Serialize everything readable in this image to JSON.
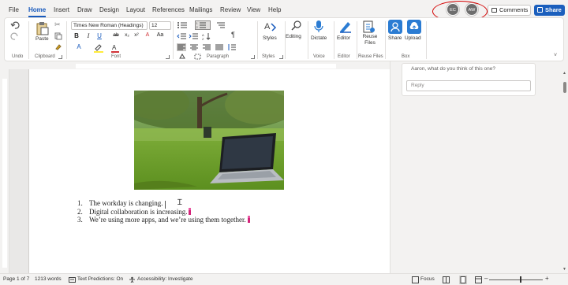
{
  "menu": {
    "tabs": [
      "File",
      "Home",
      "Insert",
      "Draw",
      "Design",
      "Layout",
      "References",
      "Mailings",
      "Review",
      "View",
      "Help"
    ],
    "active_tab": "Home"
  },
  "presence": {
    "user1": "EC",
    "user2": "AW"
  },
  "header": {
    "comments_label": "Comments",
    "share_label": "Share"
  },
  "ribbon": {
    "groups": {
      "undo": "Undo",
      "clipboard": "Clipboard",
      "font": "Font",
      "paragraph": "Paragraph",
      "styles": "Styles",
      "voice": "Voice",
      "editor": "Editor",
      "reuse_files": "Reuse Files",
      "box": "Box"
    },
    "paste_label": "Paste",
    "font_name": "Times New Roman (Headings)",
    "font_size": "12",
    "styles_label": "Styles",
    "editing_label": "Editing",
    "dictate_label": "Dictate",
    "editor_label": "Editor",
    "reuse_files_label": "Reuse Files",
    "box_share_label": "Share",
    "box_upload_label": "Upload"
  },
  "document": {
    "list": [
      {
        "num": "1.",
        "text": "The workday is changing."
      },
      {
        "num": "2.",
        "text": "Digital collaboration is increasing."
      },
      {
        "num": "3.",
        "text": "We’re using more apps, and we’re using them together."
      }
    ]
  },
  "comment_pane": {
    "comment_text": "Aaron, what do you think of this one?",
    "reply_placeholder": "Reply"
  },
  "status": {
    "page": "Page 1 of 7",
    "words": "1213 words",
    "text_predictions": "Text Predictions: On",
    "accessibility": "Accessibility: Investigate",
    "focus": "Focus"
  },
  "colors": {
    "accent": "#185abd",
    "share_button": "#1b5fbd",
    "highlight_circle": "#d40000",
    "comment_flag": "#d4237a"
  }
}
